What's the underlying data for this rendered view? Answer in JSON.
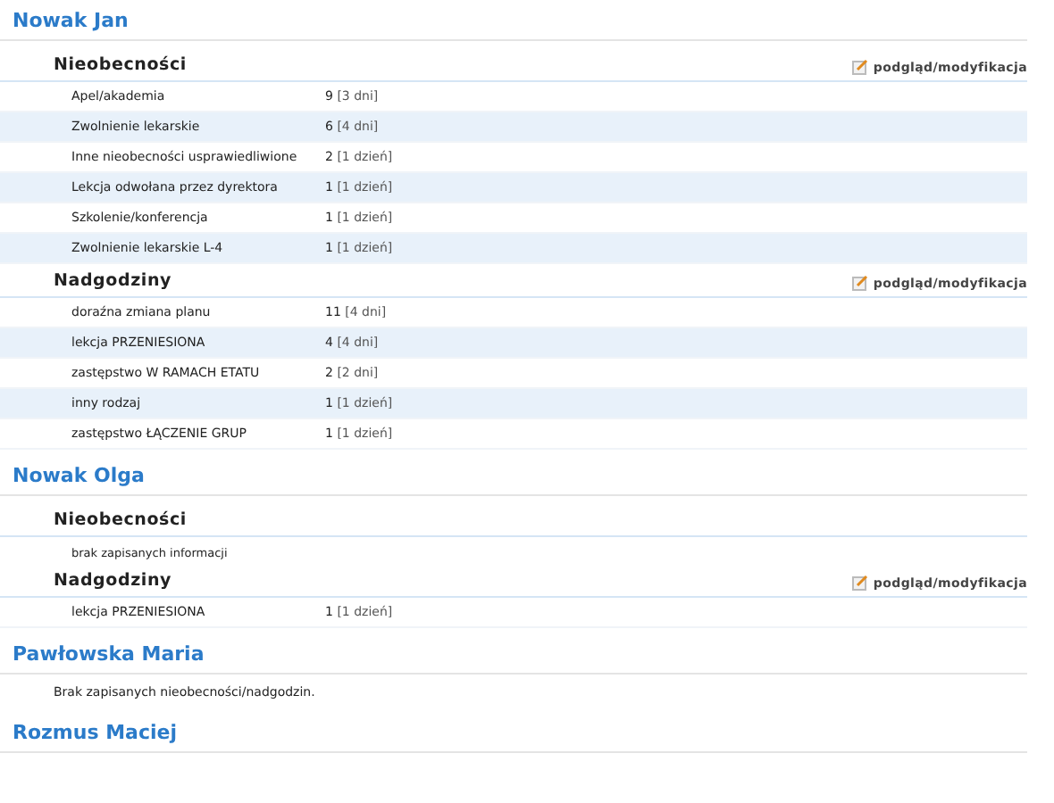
{
  "persons": [
    {
      "name": "Nowak Jan",
      "sections": [
        {
          "title": "Nieobecności",
          "link": "podgląd/modyfikacja",
          "rows": [
            {
              "label": "Apel/akademia",
              "count": "9",
              "days": "[3 dni]"
            },
            {
              "label": "Zwolnienie lekarskie",
              "count": "6",
              "days": "[4 dni]"
            },
            {
              "label": "Inne nieobecności usprawiedliwione",
              "count": "2",
              "days": "[1 dzień]"
            },
            {
              "label": "Lekcja odwołana przez dyrektora",
              "count": "1",
              "days": "[1 dzień]"
            },
            {
              "label": "Szkolenie/konferencja",
              "count": "1",
              "days": "[1 dzień]"
            },
            {
              "label": "Zwolnienie lekarskie L-4",
              "count": "1",
              "days": "[1 dzień]"
            }
          ]
        },
        {
          "title": "Nadgodziny",
          "link": "podgląd/modyfikacja",
          "rows": [
            {
              "label": "doraźna zmiana planu",
              "count": "11",
              "days": "[4 dni]"
            },
            {
              "label": "lekcja PRZENIESIONA",
              "count": "4",
              "days": "[4 dni]"
            },
            {
              "label": "zastępstwo W RAMACH ETATU",
              "count": "2",
              "days": "[2 dni]"
            },
            {
              "label": "inny rodzaj",
              "count": "1",
              "days": "[1 dzień]"
            },
            {
              "label": "zastępstwo ŁĄCZENIE GRUP",
              "count": "1",
              "days": "[1 dzień]"
            }
          ]
        }
      ]
    },
    {
      "name": "Nowak Olga",
      "sections": [
        {
          "title": "Nieobecności",
          "empty": "brak zapisanych informacji"
        },
        {
          "title": "Nadgodziny",
          "link": "podgląd/modyfikacja",
          "rows": [
            {
              "label": "lekcja PRZENIESIONA",
              "count": "1",
              "days": "[1 dzień]"
            }
          ]
        }
      ]
    },
    {
      "name": "Pawłowska Maria",
      "note": "Brak zapisanych nieobecności/nadgodzin."
    },
    {
      "name": "Rozmus Maciej"
    }
  ]
}
